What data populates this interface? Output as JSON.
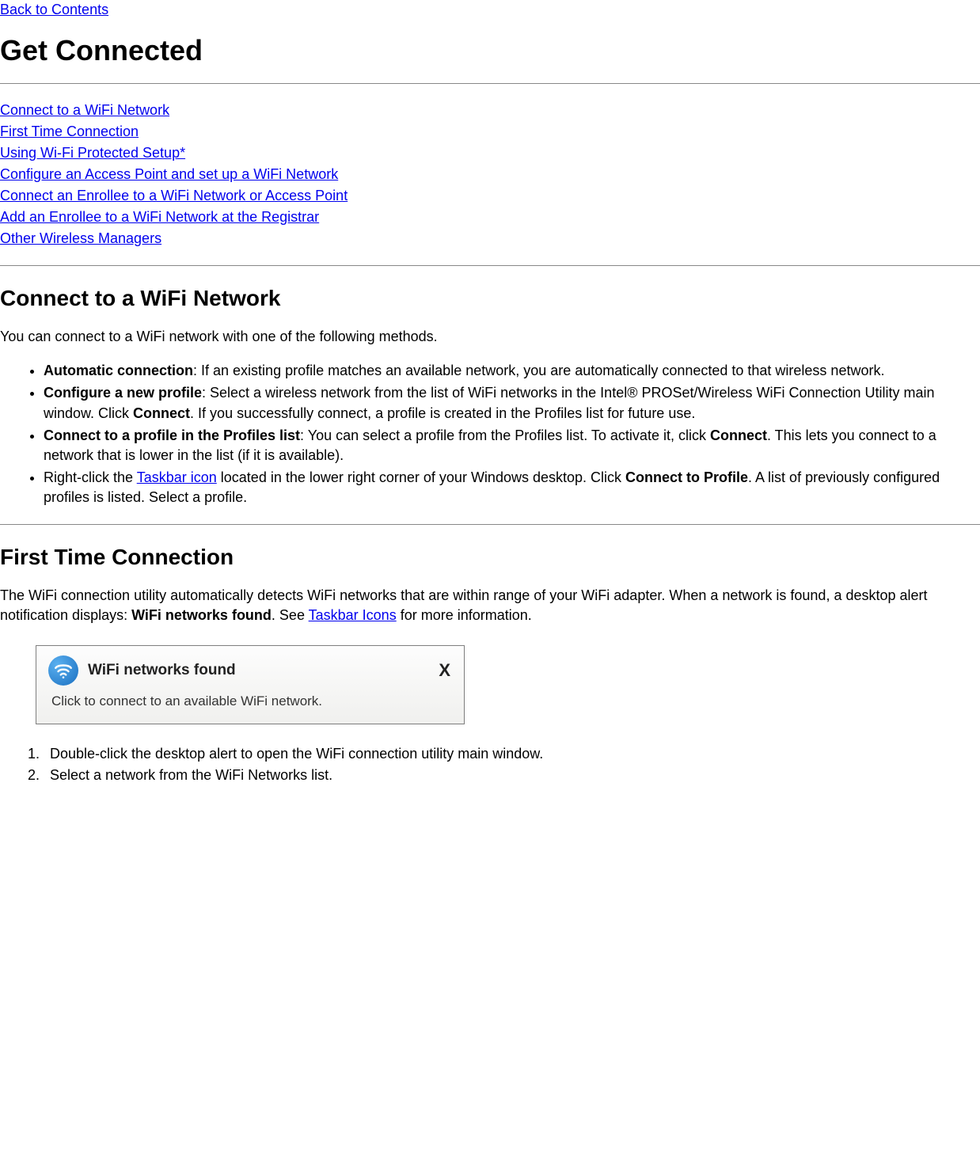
{
  "nav": {
    "back_link": "Back to Contents"
  },
  "title": "Get Connected",
  "toc": {
    "link1": "Connect to a WiFi Network",
    "link2": "First Time Connection",
    "link3": "Using Wi-Fi Protected Setup*",
    "link4": "Configure an Access Point and set up a WiFi Network ",
    "link5": "Connect an Enrollee to a WiFi Network or Access Point ",
    "link6": "Add an Enrollee to a WiFi Network at the Registrar",
    "link7": "Other Wireless Managers"
  },
  "section1": {
    "heading": "Connect to a WiFi Network",
    "intro": "You can connect to a WiFi network with one of the following methods.",
    "bullet1_bold": "Automatic connection",
    "bullet1_text": ": If an existing profile matches an available network, you are automatically connected to that wireless network.",
    "bullet2_bold": "Configure a new profile",
    "bullet2_text_a": ": Select a wireless network from the list of WiFi networks in the Intel® PROSet/Wireless WiFi Connection Utility main window. Click ",
    "bullet2_bold_b": "Connect",
    "bullet2_text_c": ". If you successfully connect, a profile is created in the Profiles list for future use.",
    "bullet3_bold": "Connect to a profile in the Profiles list",
    "bullet3_text_a": ": You can select a profile from the Profiles list. To activate it, click ",
    "bullet3_bold_b": "Connect",
    "bullet3_text_c": ". This lets you connect to a network that is lower in the list (if it is available).",
    "bullet4_text_a": "Right-click the ",
    "bullet4_link": "Taskbar icon",
    "bullet4_text_b": " located in the lower right corner of your Windows desktop. Click ",
    "bullet4_bold": "Connect to Profile",
    "bullet4_text_c": ". A list of previously configured profiles is listed. Select a profile."
  },
  "section2": {
    "heading": "First Time Connection",
    "intro_a": "The WiFi connection utility automatically detects WiFi networks that are within range of your WiFi adapter. When a network is found, a desktop alert notification displays: ",
    "intro_bold": "WiFi networks found",
    "intro_b": ". See ",
    "intro_link": "Taskbar Icons",
    "intro_c": " for more information.",
    "notification": {
      "title": "WiFi networks found",
      "body": "Click to connect to an available WiFi network.",
      "close": "X"
    },
    "step1": "Double-click the desktop alert to open the WiFi connection utility main window.",
    "step2": "Select a network from the WiFi Networks list."
  }
}
